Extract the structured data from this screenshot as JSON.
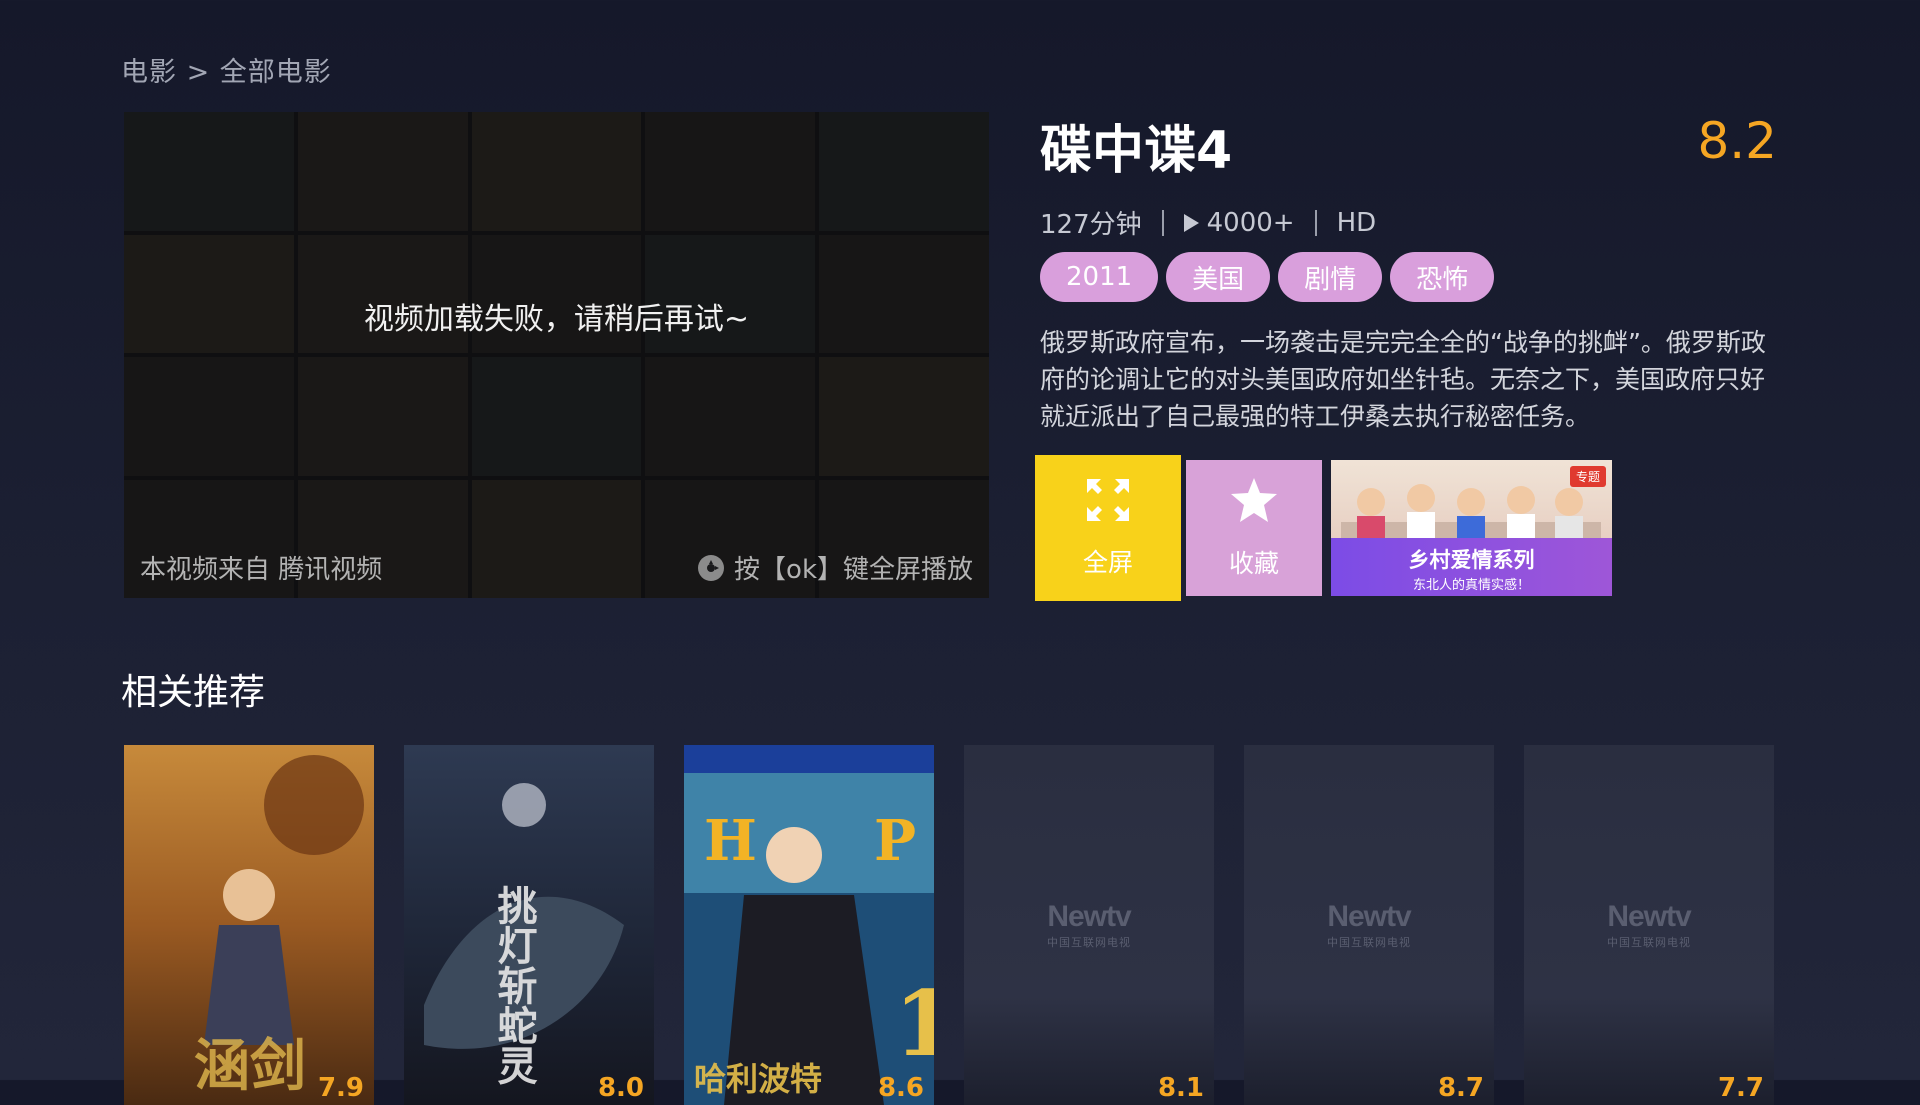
{
  "breadcrumb": "电影 > 全部电影",
  "player": {
    "error_text": "视频加载失败，请稍后再试~",
    "source_text": "本视频来自 腾讯视频",
    "hint_text": "按【ok】键全屏播放"
  },
  "movie": {
    "title": "碟中谍4",
    "rating": "8.2",
    "duration": "127分钟",
    "plays": "4000+",
    "quality": "HD",
    "tags": [
      "2011",
      "美国",
      "剧情",
      "恐怖"
    ],
    "description": "俄罗斯政府宣布，一场袭击是完完全全的“战争的挑衅”。俄罗斯政府的论调让它的对头美国政府如坐针毡。无奈之下，美国政府只好就近派出了自己最强的特工伊桑去执行秘密任务。"
  },
  "actions": {
    "fullscreen_label": "全屏",
    "favorite_label": "收藏",
    "promo_badge": "专题",
    "promo_title": "乡村爱情系列",
    "promo_subtitle": "东北人的真情实感！"
  },
  "recommend": {
    "title": "相关推荐",
    "items": [
      {
        "kind": "poster",
        "score": "7.9",
        "poster_title": "涵剑"
      },
      {
        "kind": "poster",
        "score": "8.0",
        "poster_title": "挑灯斩蛇灵"
      },
      {
        "kind": "poster",
        "score": "8.6",
        "poster_title": "哈利波特"
      },
      {
        "kind": "placeholder",
        "score": "8.1",
        "logo": "Newtv",
        "logo_sub": "中国互联网电视"
      },
      {
        "kind": "placeholder",
        "score": "8.7",
        "logo": "Newtv",
        "logo_sub": "中国互联网电视"
      },
      {
        "kind": "placeholder",
        "score": "7.7",
        "logo": "Newtv",
        "logo_sub": "中国互联网电视"
      }
    ]
  },
  "colors": {
    "accent_yellow": "#f8d21a",
    "tag_pink": "#d99fdc",
    "rating_orange": "#f5a623"
  }
}
